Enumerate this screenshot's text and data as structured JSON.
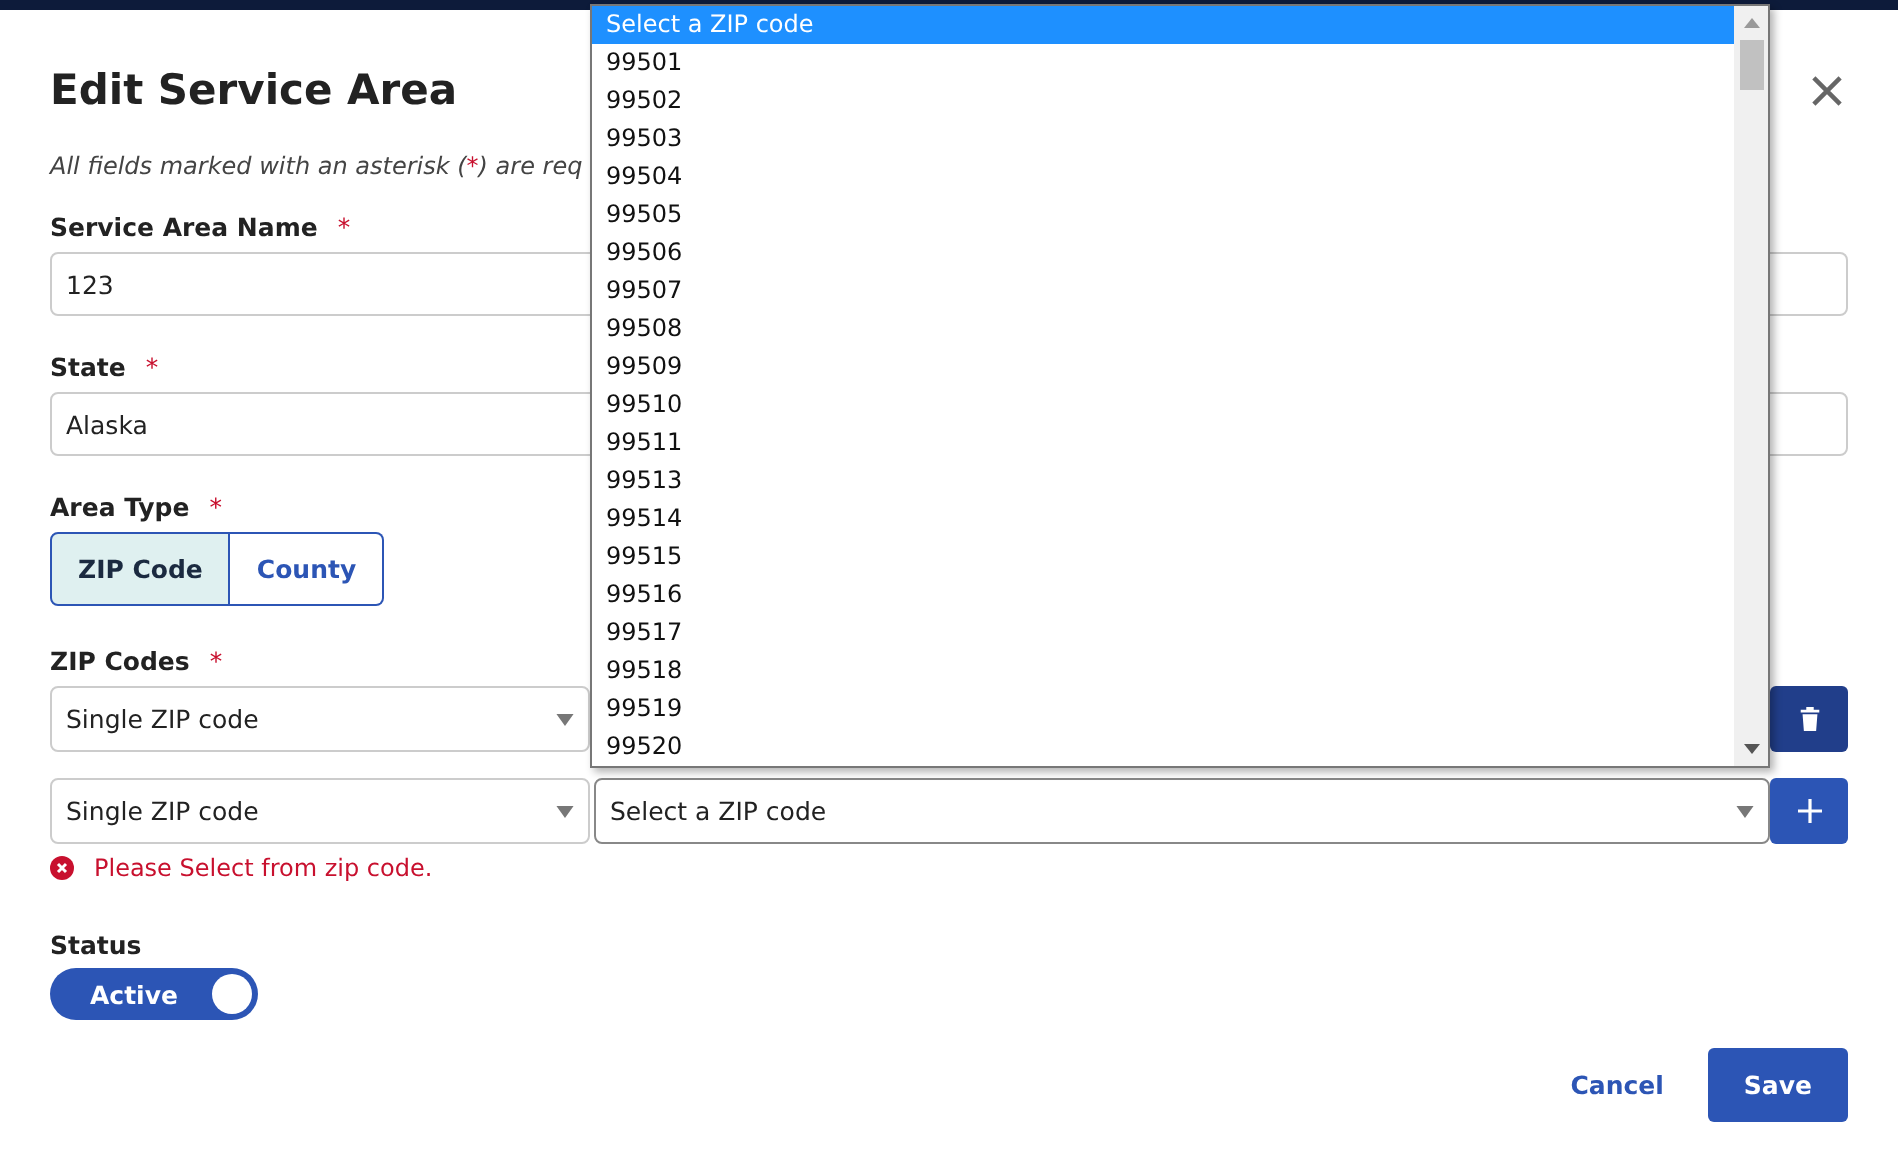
{
  "dialog": {
    "title": "Edit Service Area",
    "note": "All fields marked with an asterisk (*) are req",
    "required_mark": "*",
    "fields": [
      {
        "label": "Service Area Name",
        "required": true,
        "value": "123"
      },
      {
        "label": "State",
        "required": true,
        "value": "Alaska"
      }
    ],
    "area_type": {
      "label": "Area Type",
      "required": true,
      "options": [
        {
          "label": "ZIP Code",
          "selected": true
        },
        {
          "label": "County",
          "selected": false
        }
      ]
    },
    "zip_codes": {
      "label": "ZIP Codes",
      "required": true,
      "rows": [
        {
          "mode": "Single ZIP code",
          "zip": "",
          "kind": "delete"
        },
        {
          "mode": "Single ZIP code",
          "zip": "Select a ZIP code",
          "kind": "add"
        }
      ],
      "error": "Please Select from zip code."
    },
    "status": {
      "label": "Status",
      "toggle_label": "Active",
      "on": true
    },
    "buttons": [
      {
        "label": "Cancel",
        "kind": "link"
      },
      {
        "label": "Save",
        "kind": "primary"
      }
    ]
  },
  "zip_dropdown": {
    "options": [
      {
        "label": "Select a ZIP code",
        "selected": true
      },
      {
        "label": "99501",
        "selected": false
      },
      {
        "label": "99502",
        "selected": false
      },
      {
        "label": "99503",
        "selected": false
      },
      {
        "label": "99504",
        "selected": false
      },
      {
        "label": "99505",
        "selected": false
      },
      {
        "label": "99506",
        "selected": false
      },
      {
        "label": "99507",
        "selected": false
      },
      {
        "label": "99508",
        "selected": false
      },
      {
        "label": "99509",
        "selected": false
      },
      {
        "label": "99510",
        "selected": false
      },
      {
        "label": "99511",
        "selected": false
      },
      {
        "label": "99513",
        "selected": false
      },
      {
        "label": "99514",
        "selected": false
      },
      {
        "label": "99515",
        "selected": false
      },
      {
        "label": "99516",
        "selected": false
      },
      {
        "label": "99517",
        "selected": false
      },
      {
        "label": "99518",
        "selected": false
      },
      {
        "label": "99519",
        "selected": false
      },
      {
        "label": "99520",
        "selected": false
      }
    ]
  }
}
